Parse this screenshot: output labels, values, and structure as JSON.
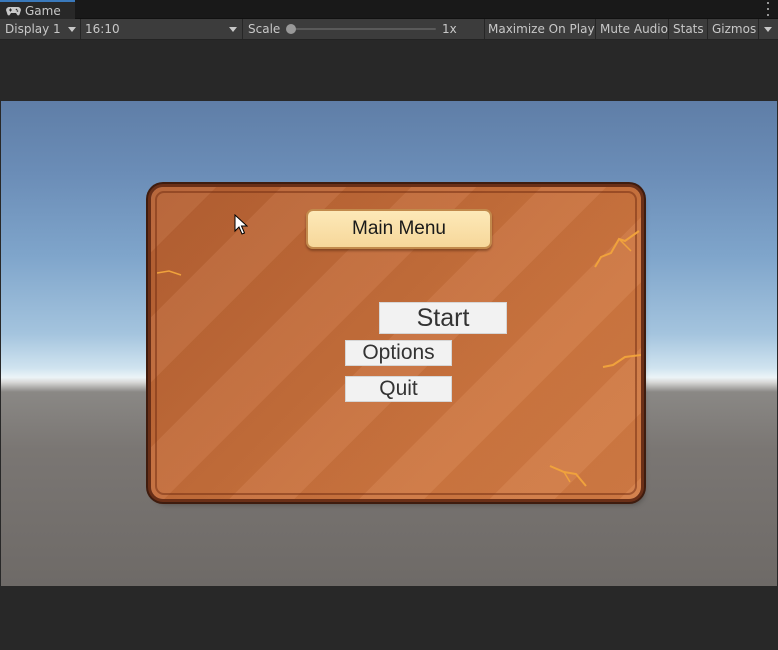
{
  "window": {
    "tab_label": "Game",
    "tab_icon": "gamepad-icon"
  },
  "toolbar": {
    "display_label": "Display 1",
    "aspect_label": "16:10",
    "scale_label": "Scale",
    "scale_value": "1x",
    "scale_fraction": 0.0,
    "maximize_label": "Maximize On Play",
    "mute_label": "Mute Audio",
    "stats_label": "Stats",
    "gizmos_label": "Gizmos"
  },
  "menu": {
    "title": "Main Menu",
    "start_label": "Start",
    "options_label": "Options",
    "quit_label": "Quit"
  },
  "colors": {
    "accent": "#3a79bb",
    "panel": "#c56d3a",
    "title_plate": "#f8dca2",
    "button": "#f2f2f2"
  }
}
